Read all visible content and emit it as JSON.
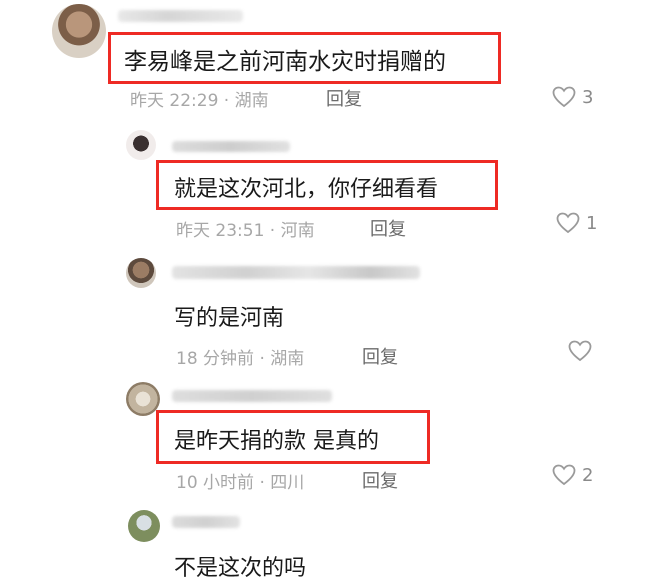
{
  "colors": {
    "highlight": "#ee2a24",
    "text": "#1a1a1a",
    "meta": "#a7a7a7",
    "reply": "#6b6b6b",
    "like_icon": "#9a9a9a"
  },
  "comments": [
    {
      "text": "李易峰是之前河南水灾时捐赠的",
      "time_location": "昨天 22:29 · 湖南",
      "reply_label": "回复",
      "like_count": "3",
      "highlighted": true,
      "icon": "heart-outline-icon"
    },
    {
      "text": "就是这次河北，你仔细看看",
      "time_location": "昨天 23:51 · 河南",
      "reply_label": "回复",
      "like_count": "1",
      "highlighted": true,
      "icon": "heart-outline-icon"
    },
    {
      "text": "写的是河南",
      "time_location": "18 分钟前 · 湖南",
      "reply_label": "回复",
      "like_count": "",
      "highlighted": false,
      "icon": "heart-outline-icon"
    },
    {
      "text": "是昨天捐的款 是真的",
      "time_location": "10 小时前 · 四川",
      "reply_label": "回复",
      "like_count": "2",
      "highlighted": true,
      "icon": "heart-outline-icon"
    },
    {
      "text": "不是这次的吗",
      "highlighted": false
    }
  ]
}
